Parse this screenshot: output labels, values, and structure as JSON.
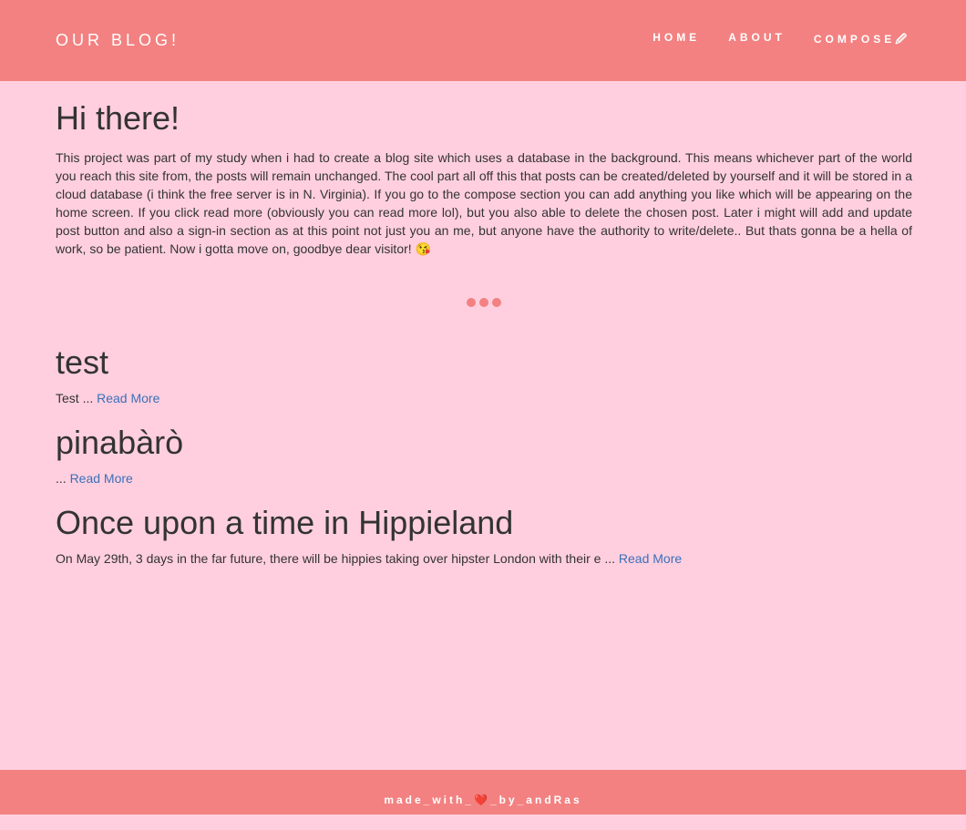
{
  "nav": {
    "brand": "OUR BLOG!",
    "links": [
      "HOME",
      "ABOUT",
      "COMPOSE🖉"
    ]
  },
  "intro": {
    "title": "Hi there!",
    "text": "This project was part of my study when i had to create a blog site which uses a database in the background. This means whichever part of the world you reach this site from, the posts will remain unchanged. The cool part all off this that posts can be created/deleted by yourself and it will be stored in a cloud database (i think the free server is in N. Virginia). If you go to the compose section you can add anything you like which will be appearing on the home screen. If you click read more (obviously you can read more lol), but you also able to delete the chosen post. Later i might will add and update post button and also a sign-in section as at this point not just you an me, but anyone have the authority to write/delete.. But thats gonna be a hella of work, so be patient. Now i gotta move on, goodbye dear visitor! 😘"
  },
  "posts": [
    {
      "title": "test",
      "excerpt": "Test ... ",
      "link": "Read More"
    },
    {
      "title": "pinabàrò",
      "excerpt": "... ",
      "link": "Read More"
    },
    {
      "title": "Once upon a time in Hippieland",
      "excerpt": "On May 29th, 3 days in the far future, there will be hippies taking over hipster London with their e ... ",
      "link": "Read More"
    }
  ],
  "footer": {
    "text": "made_with_❤️_by_andRas"
  }
}
